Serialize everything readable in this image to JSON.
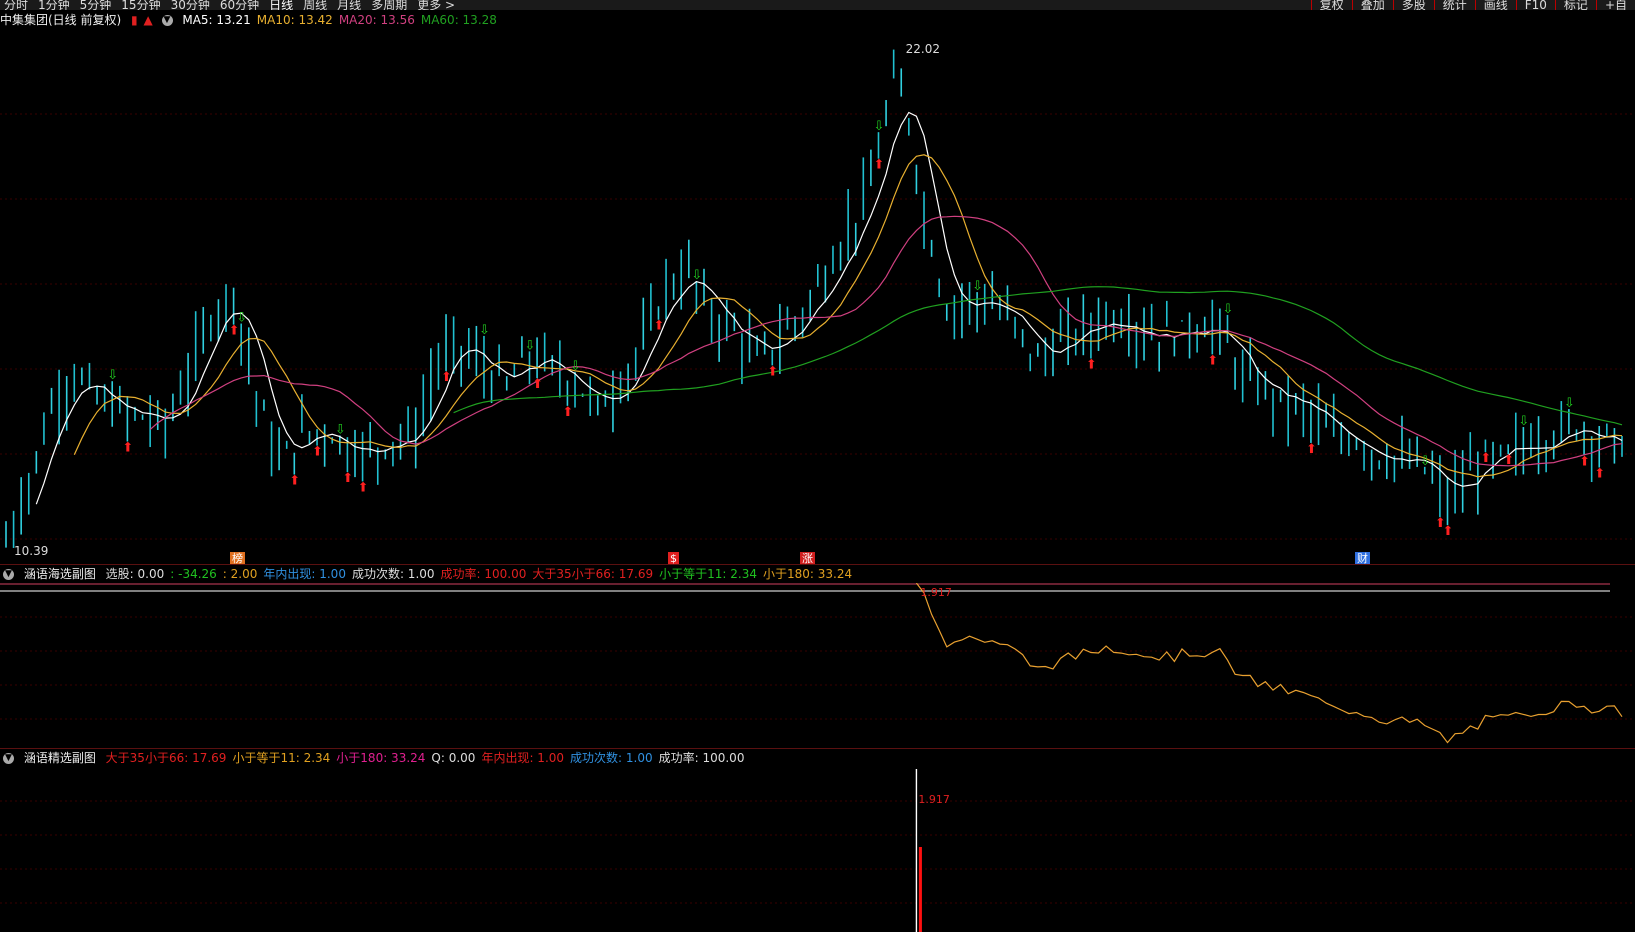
{
  "toolbar": {
    "periods": [
      "分时",
      "1分钟",
      "5分钟",
      "15分钟",
      "30分钟",
      "60分钟",
      "日线",
      "周线",
      "月线",
      "多周期",
      "更多 >"
    ],
    "active_period": "日线",
    "right_buttons": [
      "复权",
      "叠加",
      "多股",
      "统计",
      "画线",
      "F10",
      "标记",
      "+自"
    ]
  },
  "main": {
    "title": "中集集团(日线 前复权)",
    "ma": [
      {
        "label": "MA5: 13.21",
        "color": "#ffffff"
      },
      {
        "label": "MA10: 13.42",
        "color": "#e8b030"
      },
      {
        "label": "MA20: 13.56",
        "color": "#d04080"
      },
      {
        "label": "MA60: 13.28",
        "color": "#20a020"
      }
    ],
    "high_label": "22.02",
    "low_label": "10.39",
    "event_marks": [
      {
        "text": "榜",
        "color": "#e07020"
      },
      {
        "text": "$",
        "color": "#e02020"
      },
      {
        "text": "涨",
        "color": "#d02020"
      },
      {
        "text": "财",
        "color": "#3070e0"
      }
    ]
  },
  "sub1": {
    "title": "涵语海选副图",
    "items": [
      {
        "label": "选股: 0.00",
        "color": "#dddddd"
      },
      {
        "label": ": -34.26",
        "color": "#20c020"
      },
      {
        "label": ": 2.00",
        "color": "#e0a020"
      },
      {
        "label": "年内出现: 1.00",
        "color": "#3090e0"
      },
      {
        "label": "成功次数: 1.00",
        "color": "#dddddd"
      },
      {
        "label": "成功率: 100.00",
        "color": "#e02020"
      },
      {
        "label": "大于35小于66: 17.69",
        "color": "#e02020"
      },
      {
        "label": "小于等于11: 2.34",
        "color": "#20c020"
      },
      {
        "label": "小于180: 33.24",
        "color": "#e0a020"
      }
    ],
    "peak_label": "1.917"
  },
  "sub2": {
    "title": "涵语精选副图",
    "items": [
      {
        "label": "大于35小于66: 17.69",
        "color": "#e02020"
      },
      {
        "label": "小于等于11: 2.34",
        "color": "#e0a020"
      },
      {
        "label": "小于180: 33.24",
        "color": "#e02090"
      },
      {
        "label": "Q: 0.00",
        "color": "#dddddd"
      },
      {
        "label": "年内出现: 1.00",
        "color": "#e02020"
      },
      {
        "label": "成功次数: 1.00",
        "color": "#3090e0"
      },
      {
        "label": "成功率: 100.00",
        "color": "#dddddd"
      }
    ],
    "peak_label": "1.917"
  },
  "chart_data": {
    "type": "bar",
    "price_anchor_points": [
      [
        0,
        10.6
      ],
      [
        3,
        12.0
      ],
      [
        6,
        13.7
      ],
      [
        9,
        14.5
      ],
      [
        12,
        13.9
      ],
      [
        15,
        13.6
      ],
      [
        18,
        13.5
      ],
      [
        21,
        13.3
      ],
      [
        24,
        14.4
      ],
      [
        27,
        15.8
      ],
      [
        30,
        16.4
      ],
      [
        33,
        14.0
      ],
      [
        36,
        12.4
      ],
      [
        39,
        13.1
      ],
      [
        42,
        13.2
      ],
      [
        45,
        12.8
      ],
      [
        48,
        12.7
      ],
      [
        51,
        13.0
      ],
      [
        54,
        13.1
      ],
      [
        57,
        14.8
      ],
      [
        60,
        15.1
      ],
      [
        63,
        14.6
      ],
      [
        66,
        14.2
      ],
      [
        69,
        14.9
      ],
      [
        72,
        14.6
      ],
      [
        75,
        14.3
      ],
      [
        78,
        13.7
      ],
      [
        81,
        14.3
      ],
      [
        84,
        15.2
      ],
      [
        87,
        16.5
      ],
      [
        90,
        16.8
      ],
      [
        93,
        15.8
      ],
      [
        96,
        15.5
      ],
      [
        99,
        14.8
      ],
      [
        102,
        15.3
      ],
      [
        105,
        15.9
      ],
      [
        108,
        16.8
      ],
      [
        111,
        17.8
      ],
      [
        114,
        18.8
      ],
      [
        117,
        21.2
      ],
      [
        119,
        20.4
      ],
      [
        121,
        18.2
      ],
      [
        124,
        16.0
      ],
      [
        127,
        16.2
      ],
      [
        130,
        16.1
      ],
      [
        133,
        15.6
      ],
      [
        136,
        14.8
      ],
      [
        139,
        15.2
      ],
      [
        142,
        15.5
      ],
      [
        145,
        15.8
      ],
      [
        148,
        15.7
      ],
      [
        151,
        15.4
      ],
      [
        154,
        15.4
      ],
      [
        157,
        15.6
      ],
      [
        160,
        15.5
      ],
      [
        163,
        14.4
      ],
      [
        166,
        14.1
      ],
      [
        169,
        13.8
      ],
      [
        172,
        13.6
      ],
      [
        175,
        13.0
      ],
      [
        178,
        13.0
      ],
      [
        181,
        12.6
      ],
      [
        184,
        12.5
      ],
      [
        187,
        12.3
      ],
      [
        190,
        11.6
      ],
      [
        192,
        12.0
      ],
      [
        195,
        12.5
      ],
      [
        198,
        12.6
      ],
      [
        201,
        12.9
      ],
      [
        204,
        13.1
      ],
      [
        207,
        13.3
      ],
      [
        210,
        13.0
      ],
      [
        213,
        12.9
      ]
    ],
    "bars": 214,
    "ylim": [
      10.39,
      22.02
    ],
    "ma_periods": [
      5,
      10,
      20,
      60
    ],
    "sub1_line": {
      "start_index": 120,
      "peak": 1.917,
      "values_note": ""
    },
    "sub2_spike_index": 120
  }
}
